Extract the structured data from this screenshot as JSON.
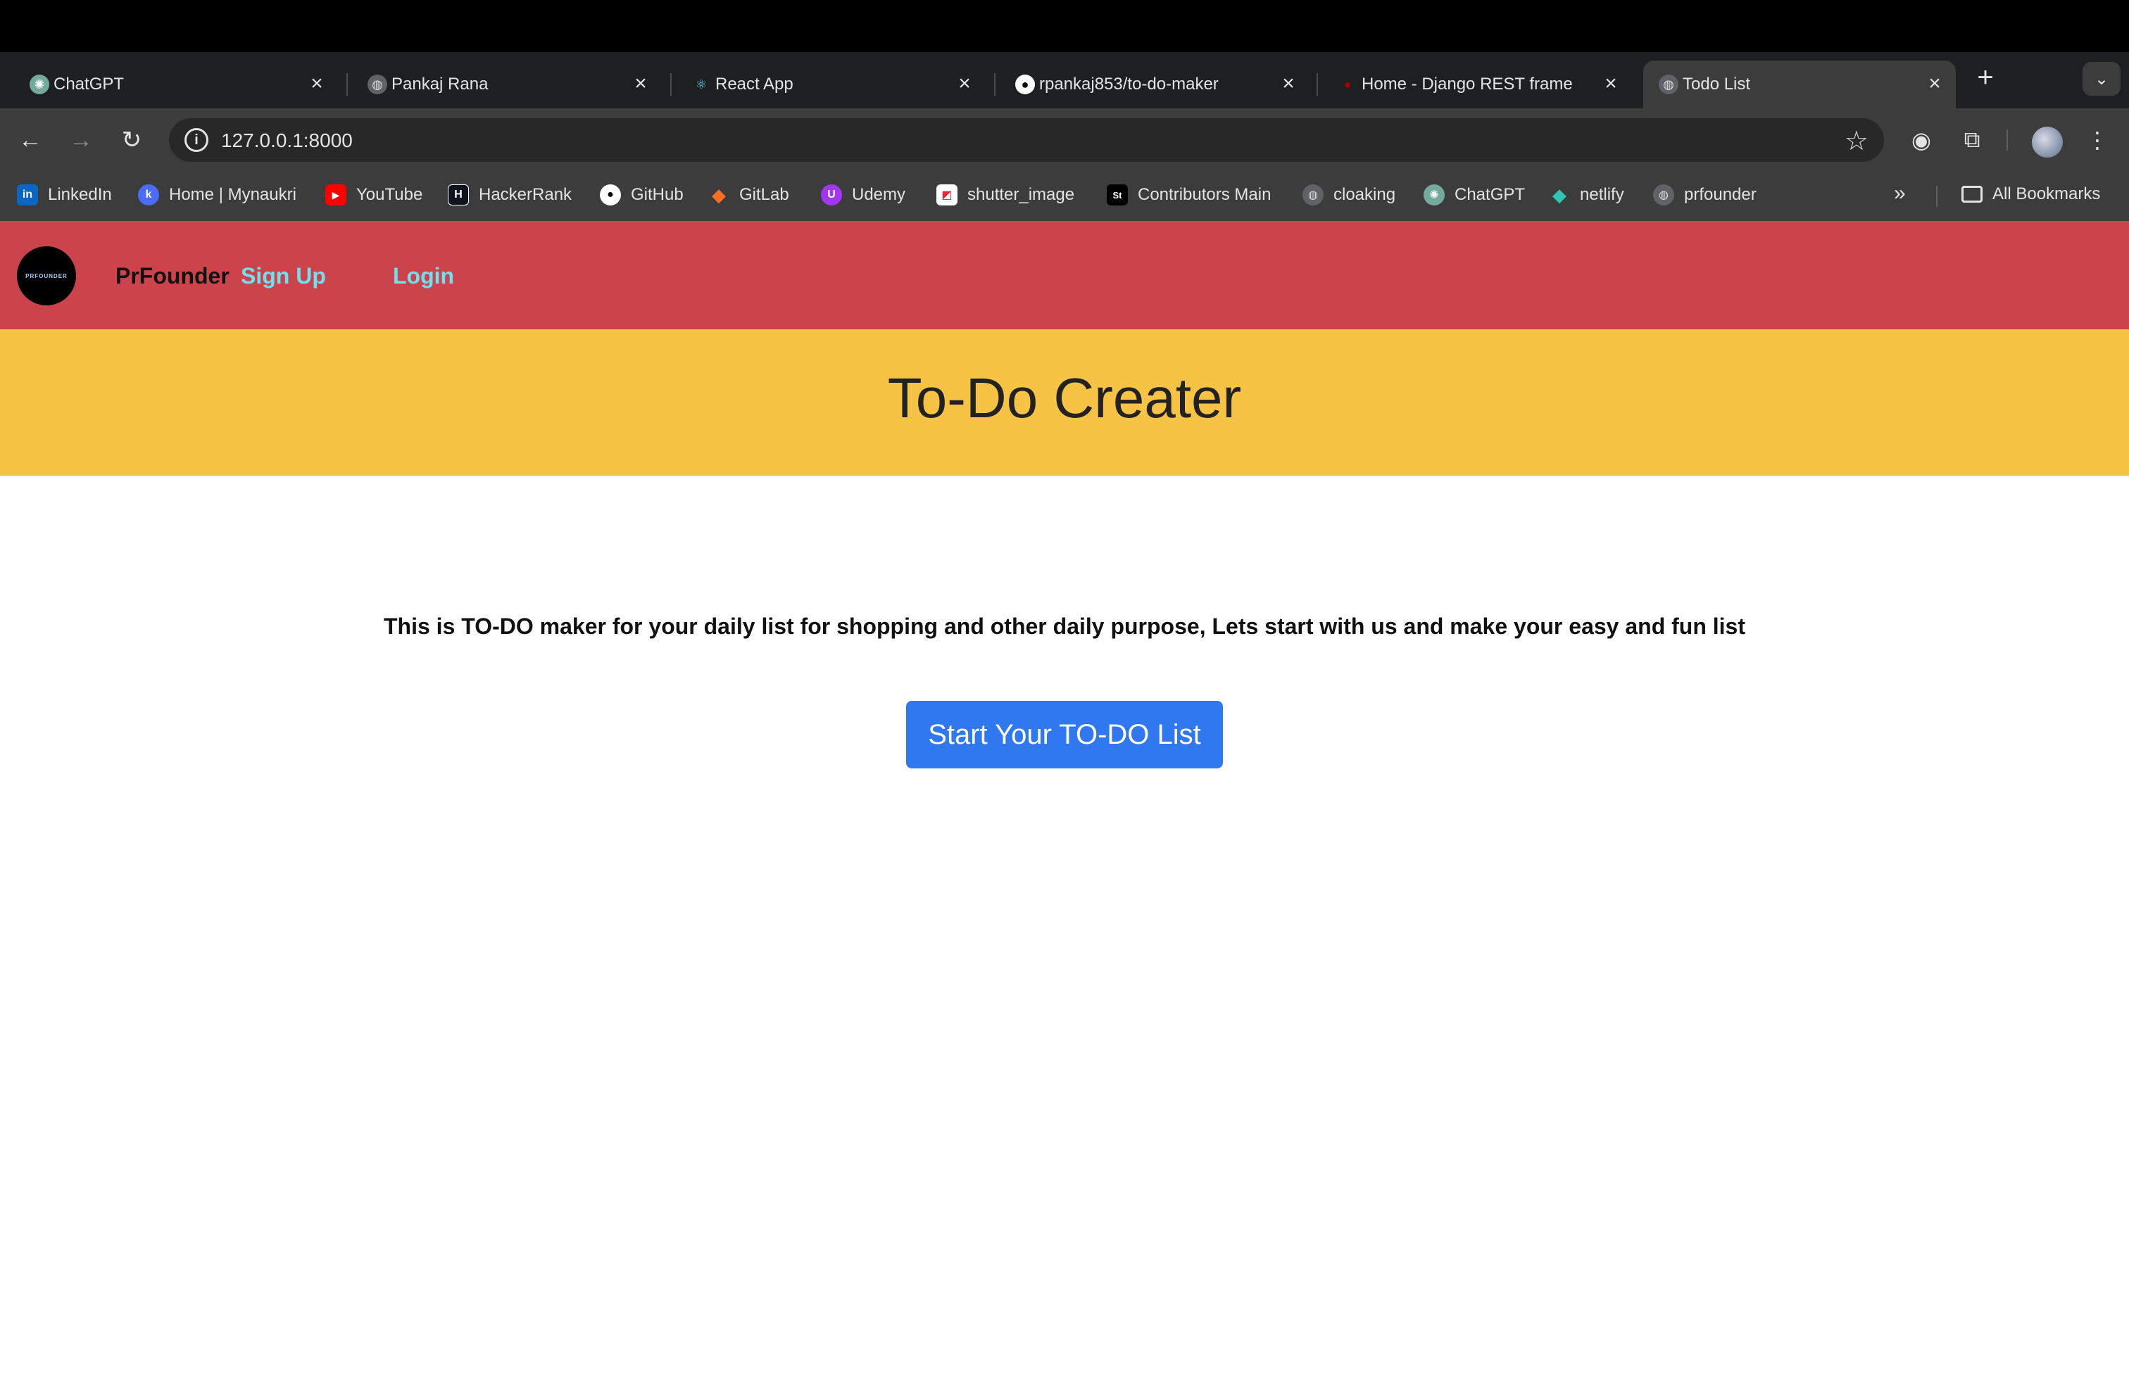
{
  "browser": {
    "tabs": [
      {
        "title": "ChatGPT",
        "icon": "chatgpt-icon",
        "active": false
      },
      {
        "title": "Pankaj Rana",
        "icon": "globe-icon",
        "active": false
      },
      {
        "title": "React App",
        "icon": "react-icon",
        "active": false
      },
      {
        "title": "rpankaj853/to-do-maker",
        "icon": "github-icon",
        "active": false
      },
      {
        "title": "Home - Django REST frame",
        "icon": "django-icon",
        "active": false
      },
      {
        "title": "Todo List",
        "icon": "globe-icon",
        "active": true
      }
    ],
    "url": "127.0.0.1:8000",
    "bookmarks": [
      {
        "label": "LinkedIn",
        "icon": "linkedin-icon",
        "color": "#0a66c2",
        "glyph": "in"
      },
      {
        "label": "Home | Mynaukri",
        "icon": "mynaukri-icon",
        "color": "#4a6cf7",
        "glyph": "k"
      },
      {
        "label": "YouTube",
        "icon": "youtube-icon",
        "color": "#ff0000",
        "glyph": "▶"
      },
      {
        "label": "HackerRank",
        "icon": "hackerrank-icon",
        "color": "#0e141e",
        "glyph": "H"
      },
      {
        "label": "GitHub",
        "icon": "github-icon",
        "color": "#3c3c3c",
        "glyph": "●"
      },
      {
        "label": "GitLab",
        "icon": "gitlab-icon",
        "color": "#fc6d26",
        "glyph": "◆"
      },
      {
        "label": "Udemy",
        "icon": "udemy-icon",
        "color": "#a435f0",
        "glyph": "U"
      },
      {
        "label": "shutter_image",
        "icon": "shutter-icon",
        "color": "#ffffff",
        "glyph": "◩"
      },
      {
        "label": "Contributors Main",
        "icon": "contributors-icon",
        "color": "#000000",
        "glyph": "St"
      },
      {
        "label": "cloaking",
        "icon": "globe-icon",
        "color": "#3c3c3c",
        "glyph": "◍"
      },
      {
        "label": "ChatGPT",
        "icon": "chatgpt-icon",
        "color": "#74aa9c",
        "glyph": "✺"
      },
      {
        "label": "netlify",
        "icon": "netlify-icon",
        "color": "#3c3c3c",
        "glyph": "◆"
      },
      {
        "label": "prfounder",
        "icon": "globe-icon",
        "color": "#3c3c3c",
        "glyph": "◍"
      }
    ],
    "all_bookmarks_label": "All Bookmarks"
  },
  "page": {
    "logo_text": "PRFOUNDER",
    "brand": "PrFounder",
    "nav": {
      "signup": "Sign Up",
      "login": "Login"
    },
    "hero_title": "To-Do Creater",
    "description": "This is TO-DO maker for your daily list for shopping and other daily purpose, Lets start with us and make your easy and fun list",
    "cta_label": "Start Your TO-DO List"
  },
  "colors": {
    "navbar": "#cc444b",
    "hero": "#f6c344",
    "nav_link": "#6fe0f0",
    "cta": "#2f78f0"
  }
}
